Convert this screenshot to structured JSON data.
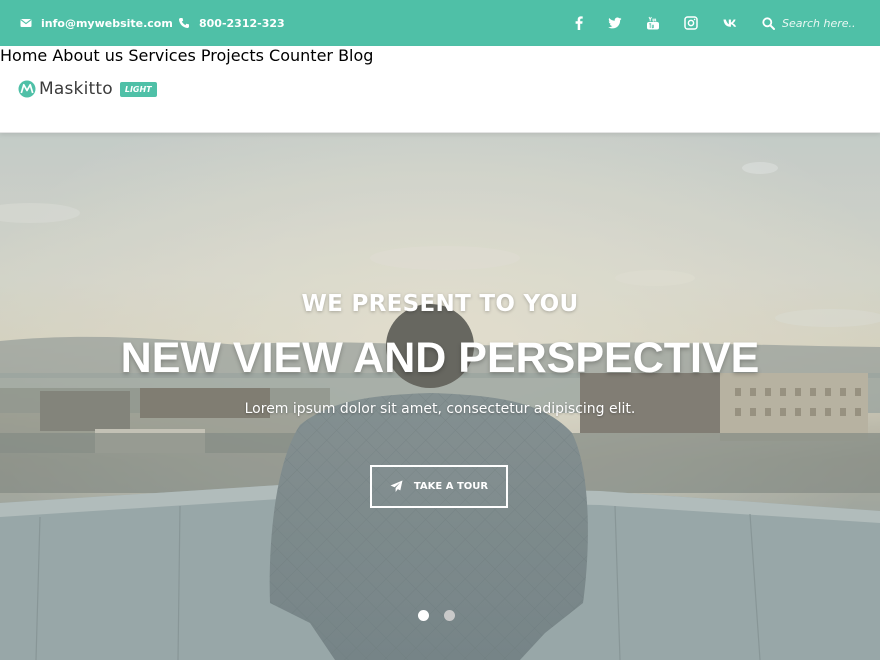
{
  "colors": {
    "accent": "#4fc0a7",
    "white": "#ffffff",
    "nav_text": "#555555",
    "dot_active": "#ffffff",
    "dot_inactive": "#c9c9c9"
  },
  "topbar": {
    "email": "info@mywebsite.com",
    "phone": "800-2312-323",
    "social_icons": [
      "facebook-icon",
      "twitter-icon",
      "youtube-icon",
      "instagram-icon",
      "vk-icon"
    ],
    "search_placeholder": "Search here.."
  },
  "header": {
    "logo_name": "Maskitto",
    "logo_badge": "LIGHT",
    "nav": [
      "Home",
      "About us",
      "Services",
      "Projects",
      "Counter",
      "Blog"
    ]
  },
  "hero": {
    "pretitle": "WE PRESENT TO YOU",
    "title": "NEW VIEW AND PERSPECTIVE",
    "subtitle": "Lorem ipsum dolor sit amet, consectetur adipiscing elit.",
    "button": "TAKE A TOUR",
    "slides": [
      "slide-1",
      "slide-2"
    ],
    "active_slide": 1
  }
}
